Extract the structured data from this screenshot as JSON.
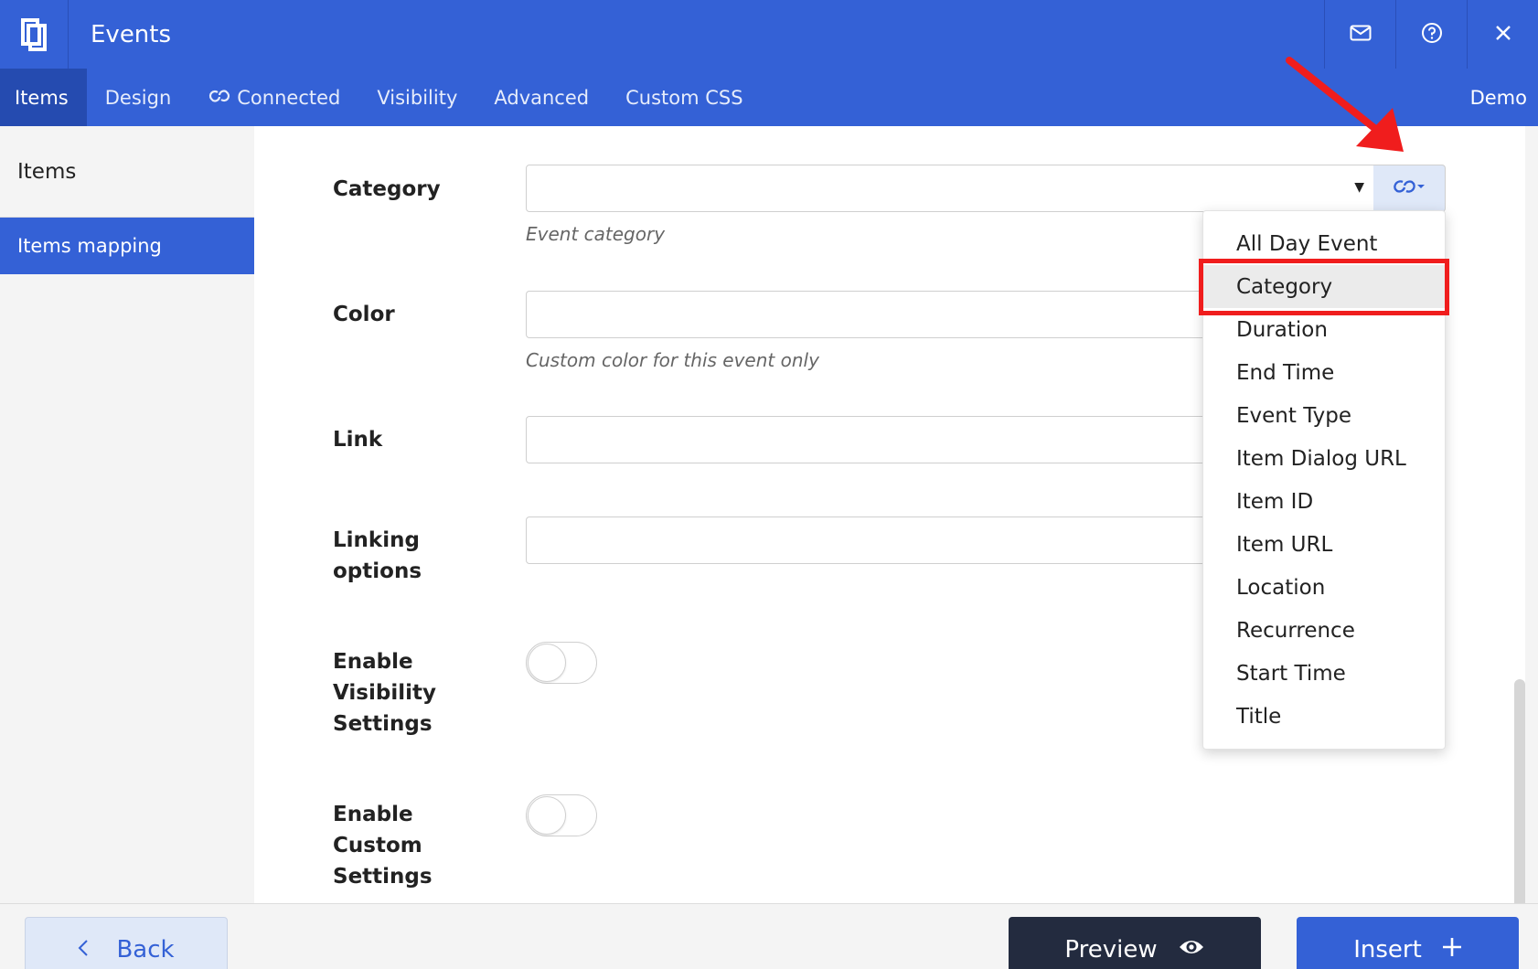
{
  "header": {
    "title": "Events",
    "icons": {
      "logo": "app-logo",
      "mail": "mail-icon",
      "help": "help-icon",
      "close": "close-icon"
    }
  },
  "tabs": [
    {
      "label": "Items",
      "active": true
    },
    {
      "label": "Design"
    },
    {
      "label": "Connected",
      "icon": "link-icon"
    },
    {
      "label": "Visibility"
    },
    {
      "label": "Advanced"
    },
    {
      "label": "Custom CSS"
    }
  ],
  "tab_right": "Demo",
  "sidebar": {
    "items": [
      {
        "label": "Items"
      },
      {
        "label": "Items mapping",
        "active": true
      }
    ]
  },
  "form": {
    "category": {
      "label": "Category",
      "value": "",
      "help": "Event category"
    },
    "color": {
      "label": "Color",
      "value": "",
      "help": "Custom color for this event only"
    },
    "link": {
      "label": "Link",
      "value": ""
    },
    "linking_options": {
      "label_line1": "Linking",
      "label_line2": "options",
      "value": ""
    },
    "enable_visibility": {
      "label_line1": "Enable",
      "label_line2": "Visibility",
      "label_line3": "Settings",
      "on": false
    },
    "enable_custom": {
      "label_line1": "Enable",
      "label_line2": "Custom",
      "label_line3": "Settings",
      "on": false
    }
  },
  "dropdown": {
    "items": [
      "All Day Event",
      "Category",
      "Duration",
      "End Time",
      "Event Type",
      "Item Dialog URL",
      "Item ID",
      "Item URL",
      "Location",
      "Recurrence",
      "Start Time",
      "Title"
    ],
    "selected": "Category"
  },
  "footer": {
    "back_label": "Back",
    "preview_label": "Preview",
    "insert_label": "Insert"
  },
  "colors": {
    "accent": "#3461d6",
    "dark_button": "#232b3f",
    "annotation": "#f01d1d"
  }
}
